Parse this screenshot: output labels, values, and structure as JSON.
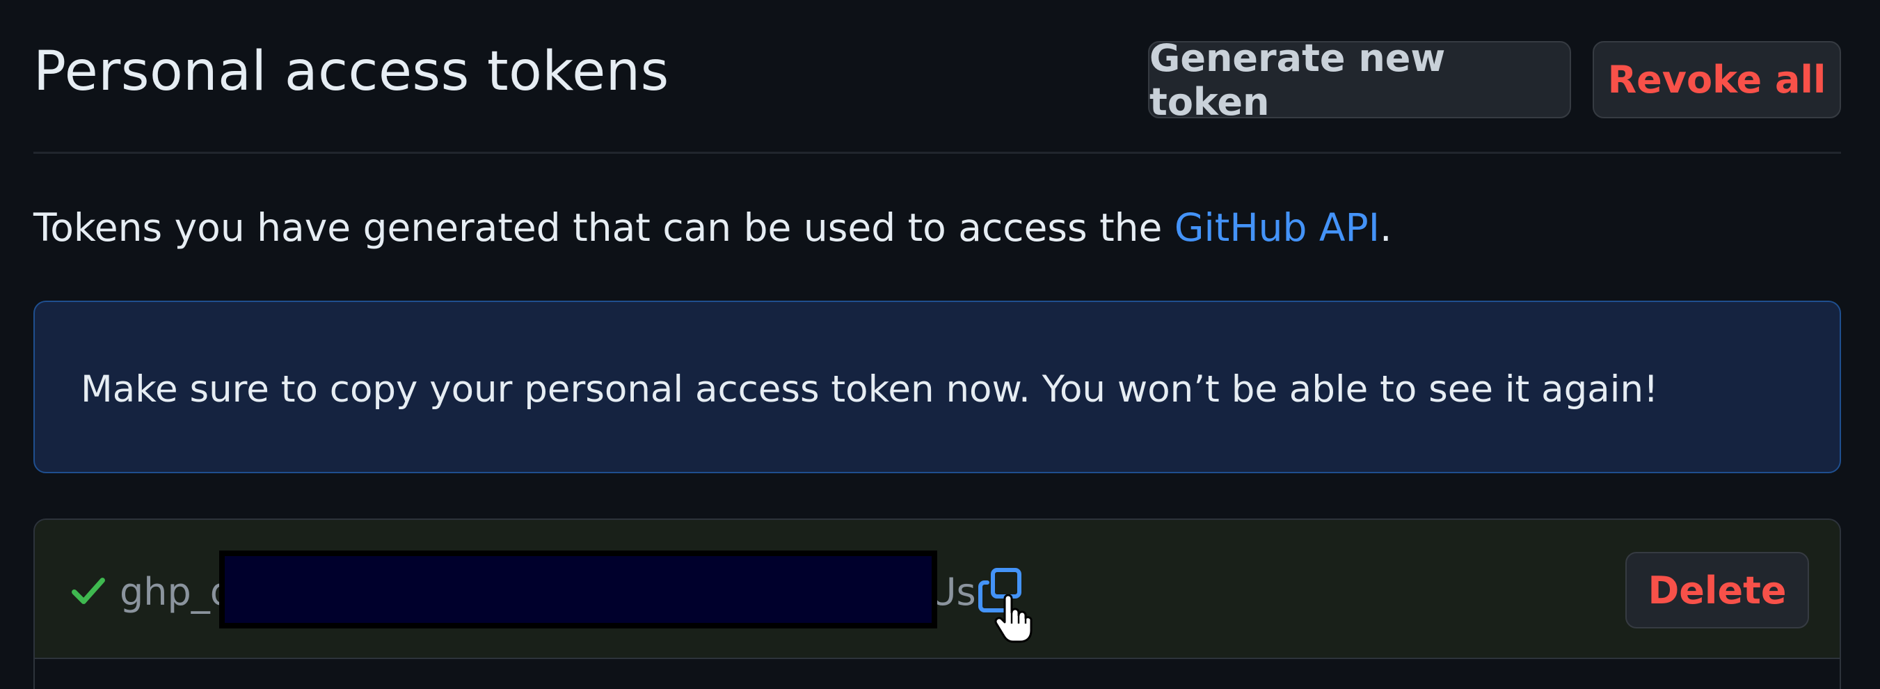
{
  "header": {
    "title": "Personal access tokens",
    "generate_label": "Generate new token",
    "revoke_label": "Revoke all"
  },
  "description": {
    "prefix": "Tokens you have generated that can be used to access the ",
    "link_text": "GitHub API",
    "suffix": "."
  },
  "flash": {
    "message": "Make sure to copy your personal access token now. You won’t be able to see it again!"
  },
  "token": {
    "prefix": "ghp_d",
    "suffix": "Us",
    "status_icon": "check-icon",
    "copy_icon": "copy-icon",
    "delete_label": "Delete"
  },
  "colors": {
    "background": "#0d1117",
    "link": "#4493f8",
    "danger": "#f85149",
    "success": "#3fb950",
    "flash_bg": "#152340"
  }
}
